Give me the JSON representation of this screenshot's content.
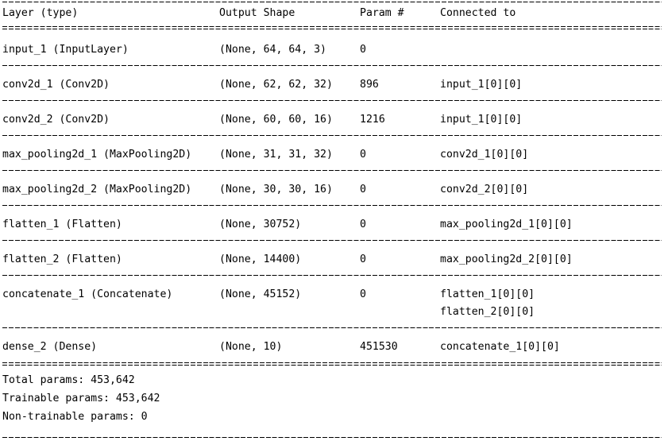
{
  "table": {
    "headers": {
      "layer": "Layer (type)",
      "shape": "Output Shape",
      "param": "Param #",
      "connected": "Connected to"
    },
    "rows": [
      {
        "layer": "input_1 (InputLayer)",
        "shape": "(None, 64, 64, 3)",
        "param": "0",
        "connected": [
          "",
          ""
        ]
      },
      {
        "layer": "conv2d_1 (Conv2D)",
        "shape": "(None, 62, 62, 32)",
        "param": "896",
        "connected": [
          "input_1[0][0]",
          ""
        ]
      },
      {
        "layer": "conv2d_2 (Conv2D)",
        "shape": "(None, 60, 60, 16)",
        "param": "1216",
        "connected": [
          "input_1[0][0]",
          ""
        ]
      },
      {
        "layer": "max_pooling2d_1 (MaxPooling2D)",
        "shape": "(None, 31, 31, 32)",
        "param": "0",
        "connected": [
          "conv2d_1[0][0]",
          ""
        ]
      },
      {
        "layer": "max_pooling2d_2 (MaxPooling2D)",
        "shape": "(None, 30, 30, 16)",
        "param": "0",
        "connected": [
          "conv2d_2[0][0]",
          ""
        ]
      },
      {
        "layer": "flatten_1 (Flatten)",
        "shape": "(None, 30752)",
        "param": "0",
        "connected": [
          "max_pooling2d_1[0][0]",
          ""
        ]
      },
      {
        "layer": "flatten_2 (Flatten)",
        "shape": "(None, 14400)",
        "param": "0",
        "connected": [
          "max_pooling2d_2[0][0]",
          ""
        ]
      },
      {
        "layer": "concatenate_1 (Concatenate)",
        "shape": "(None, 45152)",
        "param": "0",
        "connected": [
          "flatten_1[0][0]",
          "flatten_2[0][0]"
        ]
      },
      {
        "layer": "dense_2 (Dense)",
        "shape": "(None, 10)",
        "param": "451530",
        "connected": [
          "concatenate_1[0][0]",
          ""
        ]
      }
    ]
  },
  "footer": {
    "total_params": "Total params: 453,642",
    "trainable_params": "Trainable params: 453,642",
    "non_trainable_params": "Non-trainable params: 0"
  }
}
